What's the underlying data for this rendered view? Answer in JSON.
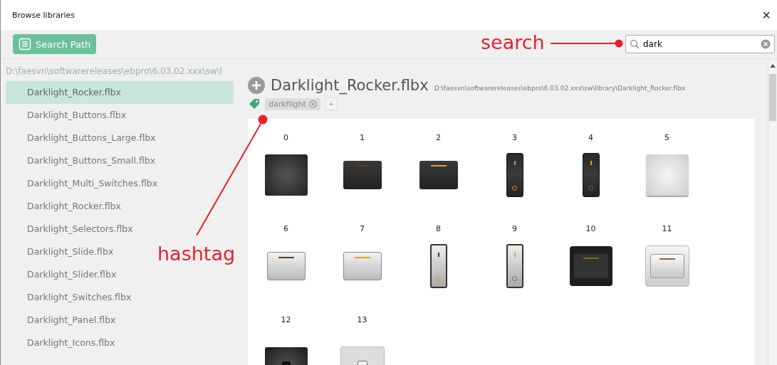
{
  "window": {
    "title": "Browse libraries",
    "close": "×"
  },
  "toolbar": {
    "search_path_button": "Search Path",
    "search": {
      "value": "dark"
    }
  },
  "sidebar": {
    "path": "D:\\faesvn\\softwarereleases\\ebpro\\6.03.02.xxx\\sw\\l",
    "items": [
      {
        "label": "Darklight_Rocker.flbx",
        "selected": true
      },
      {
        "label": "Darklight_Buttons.flbx",
        "selected": false
      },
      {
        "label": "Darklight_Buttons_Large.flbx",
        "selected": false
      },
      {
        "label": "Darklight_Buttons_Small.flbx",
        "selected": false
      },
      {
        "label": "Darklight_Multi_Switches.flbx",
        "selected": false
      },
      {
        "label": "Darklight_Rocker.flbx",
        "selected": false
      },
      {
        "label": "Darklight_Selectors.flbx",
        "selected": false
      },
      {
        "label": "Darklight_Slide.flbx",
        "selected": false
      },
      {
        "label": "Darklight_Slider.flbx",
        "selected": false
      },
      {
        "label": "Darklight_Switches.flbx",
        "selected": false
      },
      {
        "label": "Darklight_Panel.flbx",
        "selected": false
      },
      {
        "label": "Darklight_Icons.flbx",
        "selected": false
      }
    ]
  },
  "library": {
    "title": "Darklight_Rocker.flbx",
    "path": "D:\\faesvn\\softwarereleases\\ebpro\\6.03.02.xxx\\sw\\library\\Darklight_Rocker.flbx",
    "tags": [
      "darkflight"
    ],
    "add_tag": "+",
    "shapes": [
      {
        "label": "0",
        "kind": "dark-square"
      },
      {
        "label": "1",
        "kind": "dark-rocker",
        "on": false
      },
      {
        "label": "2",
        "kind": "dark-rocker",
        "on": true
      },
      {
        "label": "3",
        "kind": "dark-toggle",
        "on": false
      },
      {
        "label": "4",
        "kind": "dark-toggle",
        "on": true
      },
      {
        "label": "5",
        "kind": "light-square"
      },
      {
        "label": "6",
        "kind": "light-rocker",
        "on": false
      },
      {
        "label": "7",
        "kind": "light-rocker",
        "on": true
      },
      {
        "label": "8",
        "kind": "light-toggle",
        "on": false
      },
      {
        "label": "9",
        "kind": "light-toggle",
        "on": true
      },
      {
        "label": "10",
        "kind": "dark-framed"
      },
      {
        "label": "11",
        "kind": "light-framed"
      },
      {
        "label": "12",
        "kind": "dark-plate"
      },
      {
        "label": "13",
        "kind": "light-plate"
      }
    ]
  },
  "annotations": [
    {
      "kind": "search",
      "text": "search"
    },
    {
      "kind": "hashtag",
      "text": "hashtag"
    }
  ]
}
